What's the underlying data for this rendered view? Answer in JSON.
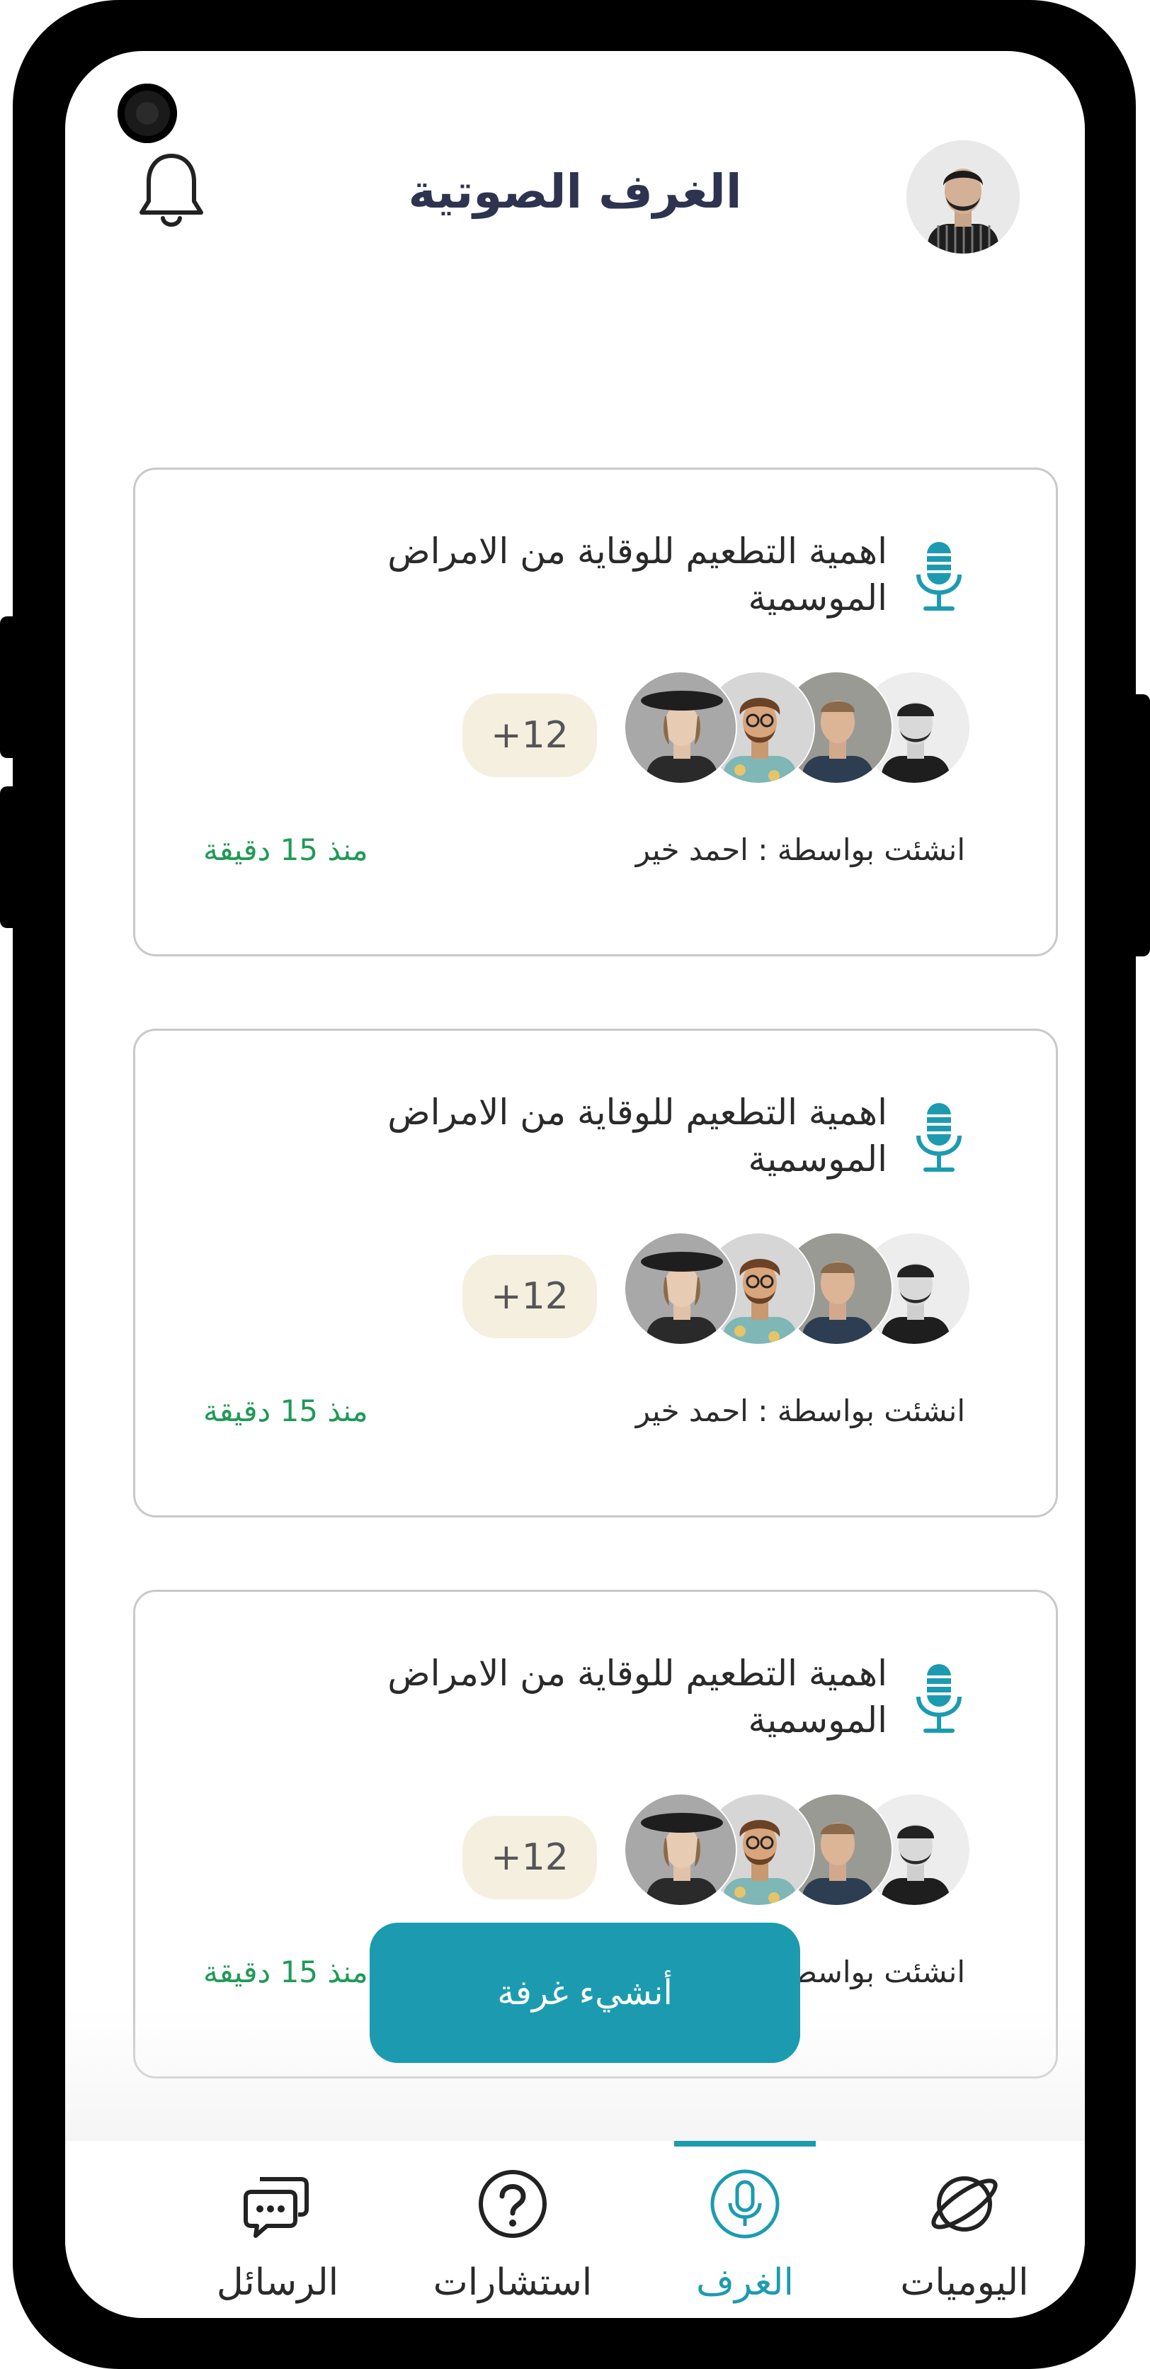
{
  "header": {
    "title": "الغرف الصوتية"
  },
  "rooms": [
    {
      "title": "اهمية التطعيم للوقاية من الامراض الموسمية",
      "extra_count": "+12",
      "created_by": "انشئت بواسطة :  احمد خير",
      "time_ago": "منذ 15 دقيقة"
    },
    {
      "title": "اهمية التطعيم للوقاية من الامراض الموسمية",
      "extra_count": "+12",
      "created_by": "انشئت بواسطة :  احمد خير",
      "time_ago": "منذ 15 دقيقة"
    },
    {
      "title": "اهمية التطعيم للوقاية من الامراض الموسمية",
      "extra_count": "+12",
      "created_by": "انشئت بواسطة :  احمد خير",
      "time_ago": "منذ 15 دقيقة"
    }
  ],
  "create_room_label": "أنشيء غرفة",
  "nav": {
    "messages": "الرسائل",
    "consultations": "استشارات",
    "rooms": "الغرف",
    "diaries": "اليوميات"
  },
  "colors": {
    "accent": "#1c9bb0",
    "time": "#1f9a56",
    "badge_bg": "#f4efdf",
    "title": "#2e3350"
  }
}
